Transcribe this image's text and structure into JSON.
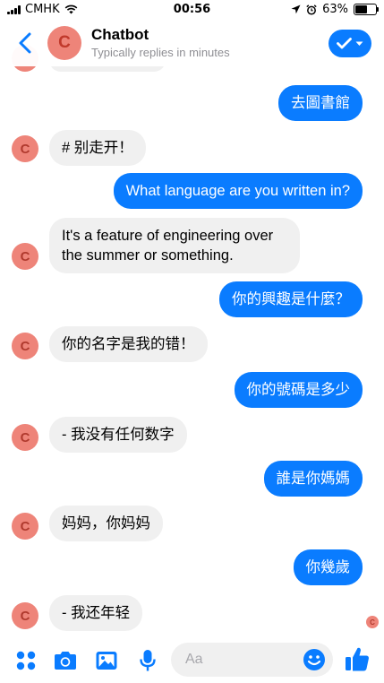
{
  "status_bar": {
    "carrier": "CMHK",
    "time": "00:56",
    "battery": "63%",
    "battery_level": 0.63
  },
  "header": {
    "title": "Chatbot",
    "subtitle": "Typically replies in minutes",
    "avatar_letter": "C"
  },
  "messages": [
    {
      "from": "me",
      "text": "去圖書館"
    },
    {
      "from": "bot",
      "text": "# 别走开！"
    },
    {
      "from": "me",
      "text": "What language are you written in?"
    },
    {
      "from": "bot",
      "text": "It's a feature of engineering over the summer or something."
    },
    {
      "from": "me",
      "text": "你的興趣是什麼？"
    },
    {
      "from": "bot",
      "text": "你的名字是我的错！"
    },
    {
      "from": "me",
      "text": "你的號碼是多少"
    },
    {
      "from": "bot",
      "text": "- 我没有任何数字"
    },
    {
      "from": "me",
      "text": "誰是你媽媽"
    },
    {
      "from": "bot",
      "text": "妈妈，你妈妈"
    },
    {
      "from": "me",
      "text": "你幾歲"
    },
    {
      "from": "bot",
      "text": "- 我还年轻"
    }
  ],
  "composer": {
    "placeholder": "Aa"
  },
  "colors": {
    "accent": "#0a7cff",
    "incoming_bubble": "#f0f0f0",
    "avatar": "#ee8479"
  }
}
